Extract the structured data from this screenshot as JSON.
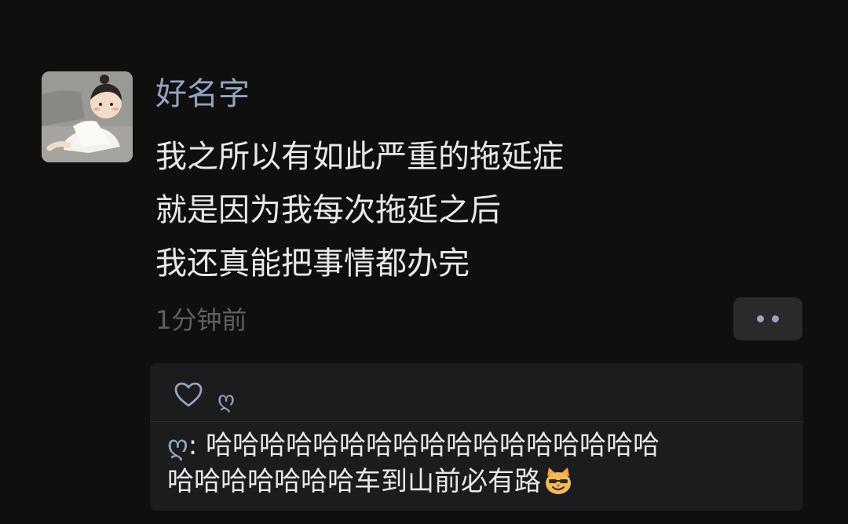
{
  "post": {
    "username": "好名字",
    "text_lines": [
      "我之所以有如此严重的拖延症",
      "就是因为我每次拖延之后",
      "我还真能把事情都办完"
    ],
    "timestamp": "1分钟前"
  },
  "interactions": {
    "likes": [
      "ღ"
    ],
    "comments": [
      {
        "author": "ღ",
        "separator": ": ",
        "text_line1": "哈哈哈哈哈哈哈哈哈哈哈哈哈哈哈哈哈",
        "text_line2": "哈哈哈哈哈哈哈车到山前必有路",
        "emoji": "grinning-cat"
      }
    ]
  },
  "icons": {
    "more": "more-dots-icon",
    "like": "heart-outline-icon"
  },
  "colors": {
    "background": "#0f0f10",
    "name_link": "#95a2bf",
    "text": "#e8e8e8",
    "muted": "#5f5f62",
    "panel": "#1c1c1e"
  }
}
